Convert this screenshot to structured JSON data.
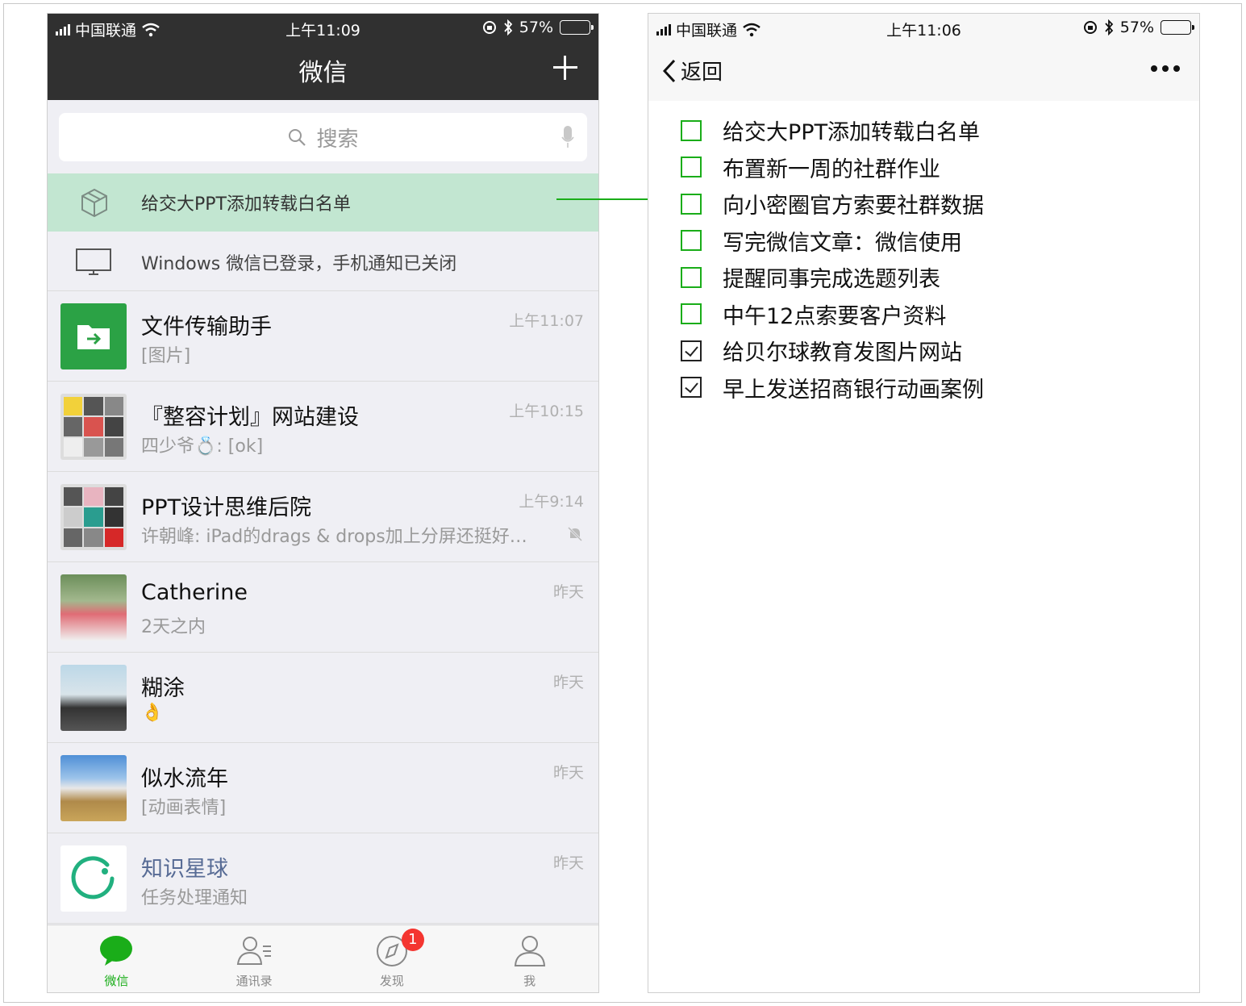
{
  "left": {
    "status": {
      "carrier": "中国联通",
      "time": "上午11:09",
      "battery": "57%"
    },
    "title": "微信",
    "search_placeholder": "搜索",
    "banner_text": "给交大PPT添加转载白名单",
    "notice_text": "Windows 微信已登录，手机通知已关闭",
    "chats": [
      {
        "name": "文件传输助手",
        "msg": "[图片]",
        "time": "上午11:07"
      },
      {
        "name": "『整容计划』网站建设",
        "msg": "四少爷💍: [ok]",
        "time": "上午10:15"
      },
      {
        "name": "PPT设计思维后院",
        "msg": "许朝峰: iPad的drags & drops加上分屏还挺好…",
        "time": "上午9:14"
      },
      {
        "name": "Catherine",
        "msg": "2天之内",
        "time": "昨天"
      },
      {
        "name": "糊涂",
        "msg": "👌",
        "time": "昨天"
      },
      {
        "name": "似水流年",
        "msg": "[动画表情]",
        "time": "昨天"
      },
      {
        "name": "知识星球",
        "msg": "任务处理通知",
        "time": "昨天"
      }
    ],
    "tabs": [
      {
        "label": "微信"
      },
      {
        "label": "通讯录"
      },
      {
        "label": "发现",
        "badge": "1"
      },
      {
        "label": "我"
      }
    ]
  },
  "right": {
    "status": {
      "carrier": "中国联通",
      "time": "上午11:06",
      "battery": "57%"
    },
    "back_label": "返回",
    "todos": [
      {
        "text": "给交大PPT添加转载白名单",
        "done": false
      },
      {
        "text": "布置新一周的社群作业",
        "done": false
      },
      {
        "text": "向小密圈官方索要社群数据",
        "done": false
      },
      {
        "text": "写完微信文章：微信使用",
        "done": false
      },
      {
        "text": "提醒同事完成选题列表",
        "done": false
      },
      {
        "text": "中午12点索要客户资料",
        "done": false
      },
      {
        "text": "给贝尔球教育发图片网站",
        "done": true
      },
      {
        "text": "早上发送招商银行动画案例",
        "done": true
      }
    ]
  },
  "colors": {
    "wechat_green": "#1aad19",
    "header_dark": "#303030",
    "banner_green": "#c2e6d1",
    "badge_red": "#f43530",
    "link_blue": "#576b95"
  }
}
